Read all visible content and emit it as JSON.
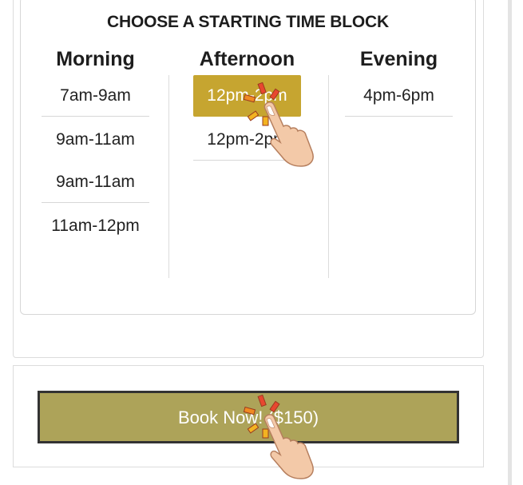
{
  "schedule": {
    "title": "CHOOSE A STARTING TIME BLOCK",
    "columns": [
      {
        "heading": "Morning",
        "slots": [
          "7am-9am",
          "9am-11am",
          "9am-11am",
          "11am-12pm"
        ]
      },
      {
        "heading": "Afternoon",
        "slots": [
          "12pm-2pm",
          "12pm-2pm"
        ],
        "selected_index": 0
      },
      {
        "heading": "Evening",
        "slots": [
          "4pm-6pm"
        ]
      }
    ]
  },
  "booking": {
    "button_label": "Book Now! ($150)"
  },
  "colors": {
    "selected": "#c6a530",
    "button": "#ada359",
    "tap_hand": "#f3c9a8",
    "tap_burst": "#e8472f"
  },
  "icons": {
    "tap_hint": "hand-tap-icon"
  }
}
